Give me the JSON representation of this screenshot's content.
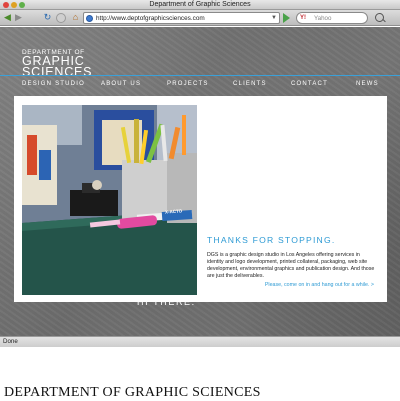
{
  "window": {
    "title": "Department of Graphic Sciences"
  },
  "toolbar": {
    "url": "http://www.deptofgraphicsciences.com",
    "search_engine_label": "Y!",
    "search_placeholder": "Yahoo"
  },
  "site": {
    "logo": {
      "line1": "DEPARTMENT OF",
      "line2": "GRAPHIC",
      "line3": "SCIENCES",
      "sub": "DESIGN STUDIO"
    },
    "nav": [
      "ABOUT US",
      "PROJECTS",
      "CLIENTS",
      "CONTACT",
      "NEWS"
    ],
    "hero_text": "HI THERE.",
    "heading": "THANKS FOR STOPPING.",
    "body": "DGS is a graphic design studio in Los Angeles offering services in identity and logo development, printed collateral, packaging, web site development, environmental graphics and publication design. And those are just the deliverables.",
    "cta": "Please, come on in and hang out for a while.  >",
    "photo_label": "X-ACTO"
  },
  "status": {
    "text": "Done"
  },
  "caption": "DEPARTMENT OF GRAPHIC SCIENCES",
  "colors": {
    "accent": "#2f9bd4",
    "background": "#747474"
  }
}
